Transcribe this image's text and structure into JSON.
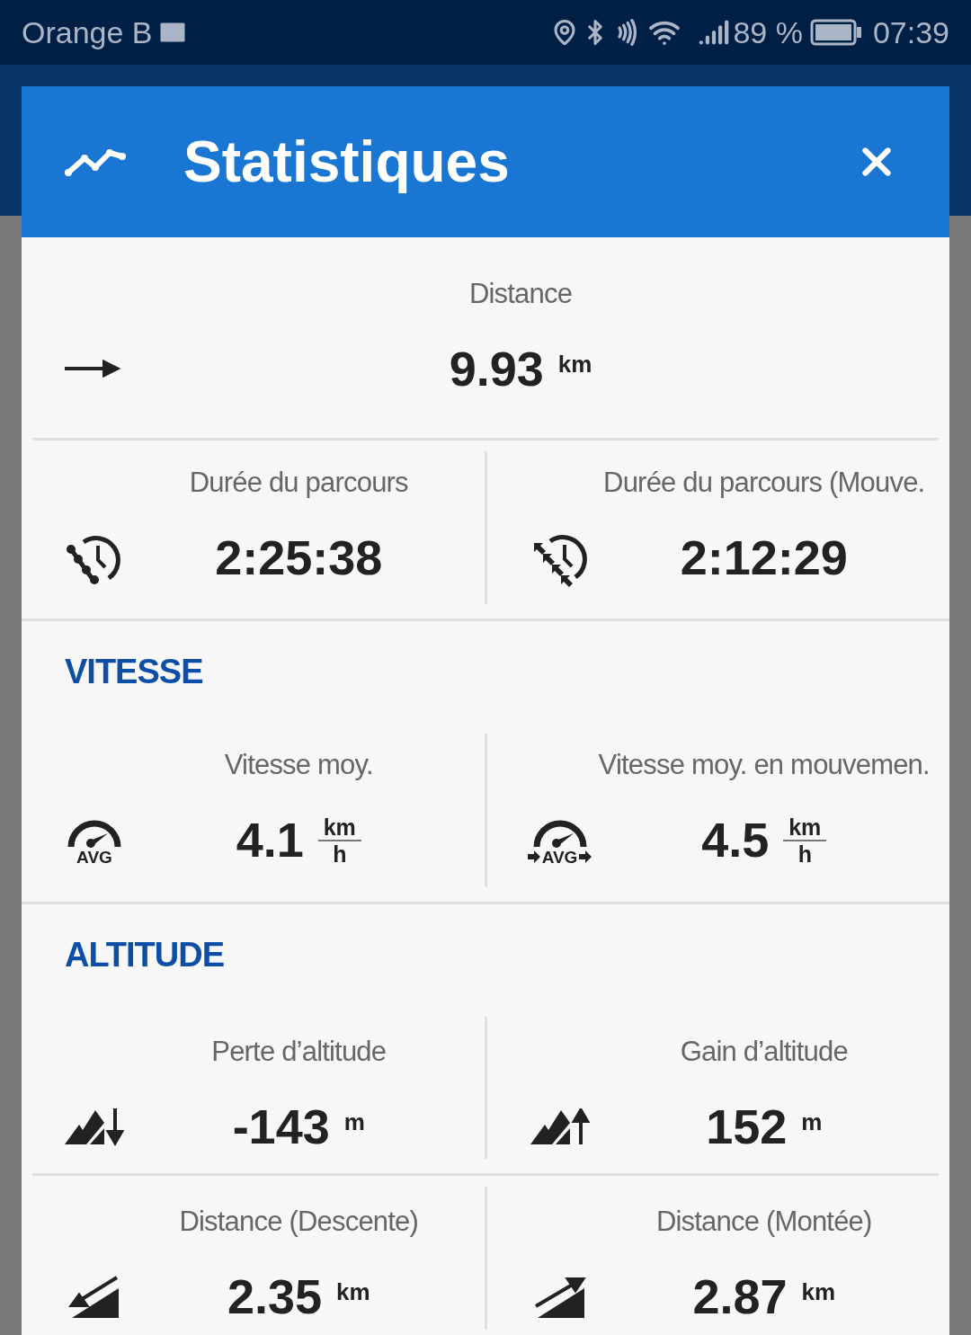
{
  "status_bar": {
    "carrier": "Orange B",
    "battery": "89 %",
    "time": "07:39"
  },
  "dialog": {
    "title": "Statistiques"
  },
  "summary": {
    "label": "Distance",
    "value": "9.93",
    "unit": {
      "kind": "plain",
      "text": "km"
    }
  },
  "rows": [
    {
      "heading": null,
      "cells": [
        {
          "label": "Durée du parcours",
          "value": "2:25:38"
        },
        {
          "label": "Durée du parcours (Mouve.",
          "value": "2:12:29"
        }
      ]
    },
    {
      "heading": "VITESSE",
      "cells": [
        {
          "label": "Vitesse moy.",
          "value": "4.1",
          "icon_text": "AVG",
          "unit": {
            "kind": "fraction",
            "top": "km",
            "bottom": "h"
          }
        },
        {
          "label": "Vitesse moy. en mouvemen.",
          "value": "4.5",
          "icon_text": "AVG",
          "unit": {
            "kind": "fraction",
            "top": "km",
            "bottom": "h"
          }
        }
      ]
    },
    {
      "heading": "ALTITUDE",
      "cells": [
        {
          "label": "Perte d’altitude",
          "value": "-143",
          "unit": {
            "kind": "plain",
            "text": "m"
          }
        },
        {
          "label": "Gain d’altitude",
          "value": "152",
          "unit": {
            "kind": "plain",
            "text": "m"
          }
        }
      ]
    },
    {
      "heading": null,
      "cells": [
        {
          "label": "Distance (Descente)",
          "value": "2.35",
          "unit": {
            "kind": "plain",
            "text": "km"
          }
        },
        {
          "label": "Distance (Montée)",
          "value": "2.87",
          "unit": {
            "kind": "plain",
            "text": "km"
          }
        }
      ]
    }
  ]
}
